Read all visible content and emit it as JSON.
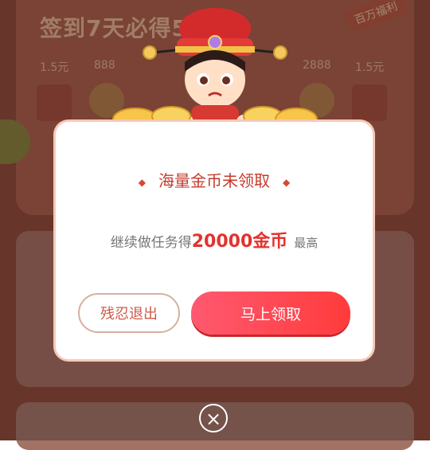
{
  "background": {
    "title": "签到7天必得5",
    "badge": "百万福利",
    "rewards": [
      {
        "label": "1.5元"
      },
      {
        "label": "888"
      },
      {
        "label": "2888"
      },
      {
        "label": "1.5元"
      }
    ]
  },
  "dialog": {
    "title": "海量金币未领取",
    "subtitle_prefix": "继续做任务得",
    "amount": "20000金币",
    "subtitle_suffix": "最高",
    "leave_button": "残忍退出",
    "claim_button": "马上领取"
  },
  "close": {
    "icon": "close-icon"
  },
  "colors": {
    "accent": "#ff4a55",
    "title_red": "#c63a2c",
    "amount_red": "#e2332f"
  }
}
